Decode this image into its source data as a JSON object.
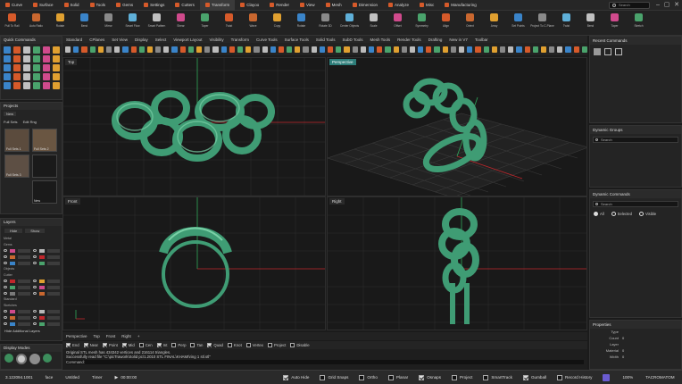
{
  "ribbon": {
    "tabs": [
      "Curve",
      "Surface",
      "Solid",
      "Tools",
      "Gems",
      "Settings",
      "Cutters",
      "Transform",
      "Clayoo",
      "Render",
      "View",
      "Mesh",
      "Dimension",
      "Analyze",
      "Misc",
      "Manufacturing"
    ],
    "active_tab": 7,
    "search_placeholder": "Search",
    "tools": [
      "Pull To Rail",
      "Auto Ratio",
      "Rotate",
      "Bend",
      "Mirror",
      "Smart Flow",
      "Smart Pattern",
      "Shear",
      "Taper",
      "Twist",
      "Wave",
      "Copy",
      "Rotate",
      "Rotate 3D",
      "Center Objects",
      "Scale",
      "Offset",
      "Symmetry",
      "Align",
      "Orient",
      "Array",
      "Set Points",
      "Project To C-Plane",
      "Twist",
      "Bend",
      "Taper",
      "Stretch"
    ]
  },
  "left": {
    "quick_commands_title": "Quick Commands",
    "projects_title": "Projects",
    "new_label": "New",
    "full_sets_label": "Full Sets",
    "edit_rings_label": "Edit Rng",
    "thumbs": [
      "Full Sets 1",
      "Full Sets 2",
      "Full Sets 3",
      ""
    ],
    "new_item_label": "New",
    "layers_title": "Layers",
    "hide_label": "Hide",
    "show_label": "Show",
    "layer_groups": [
      "Metal",
      "Gems",
      "Objects",
      "Cutter",
      "Standard",
      "Sketches"
    ],
    "hide_additional_layers": "Hide Additional Layers",
    "display_modes_title": "Display Modes"
  },
  "toolbar_tabs": [
    "Standard",
    "CPlanes",
    "Set View",
    "Display",
    "Select",
    "Viewport Layout",
    "Visibility",
    "Transform",
    "Curve Tools",
    "Surface Tools",
    "Solid Tools",
    "SubD Tools",
    "Mesh Tools",
    "Render Tools",
    "Drafting",
    "New in V7",
    "Toolbar"
  ],
  "viewports": {
    "top": "Top",
    "perspective": "Perspective",
    "front": "Front",
    "right": "Right"
  },
  "viewport_tabs": [
    "Perspective",
    "Top",
    "Front",
    "Right"
  ],
  "osnaps": [
    "End",
    "Near",
    "Point",
    "Mid",
    "Cen",
    "Int",
    "Perp",
    "Tan",
    "Quad",
    "Knot",
    "Vertex",
    "Project",
    "Disable"
  ],
  "osnaps_checked": [
    true,
    true,
    true,
    true,
    false,
    true,
    false,
    false,
    true,
    false,
    false,
    false,
    false
  ],
  "command_history": [
    "Original STL mesh has 434342 vertices and 216114 triangles.",
    "Successfully read file \"C:\\picTrawork\\Solid pc\\1.2010 STL FINAL\\KHAMI\\ring 1 stl.stl\""
  ],
  "command_prompt": "Command:",
  "right": {
    "recent_commands_title": "Recent Commands",
    "dynamic_groups_title": "Dynamic Groups",
    "dynamic_commands_title": "Dynamic Commands",
    "search_placeholder": "Search",
    "radio_all": "All",
    "radio_selected": "Selected",
    "radio_visible": "Visible",
    "properties_title": "Properties",
    "prop_keys": [
      "Type",
      "Count",
      "Layer",
      "Material",
      "Width"
    ],
    "prop_values": [
      "",
      "0",
      "",
      "0",
      "0"
    ]
  },
  "status": {
    "coords": "3.122094.1001",
    "units": "face",
    "layer": "Untitled",
    "timer_label": "Timer",
    "time": "00:00:00",
    "toggles": [
      "Auto Hide",
      "Grid Snaps",
      "Ortho",
      "Planar",
      "Osnaps",
      "Project",
      "SmartTrack",
      "Gumball",
      "Record History"
    ],
    "toggles_on": [
      true,
      false,
      false,
      false,
      true,
      false,
      false,
      true,
      false
    ],
    "zoom": "100%",
    "brand": "TACROMATOM"
  },
  "colors": {
    "accent_orange": "#d65a2a",
    "viewport_active": "#2d7d79",
    "ring_green": "#3f9c74",
    "axis_red": "#c0262b",
    "axis_green": "#2fa85a"
  }
}
